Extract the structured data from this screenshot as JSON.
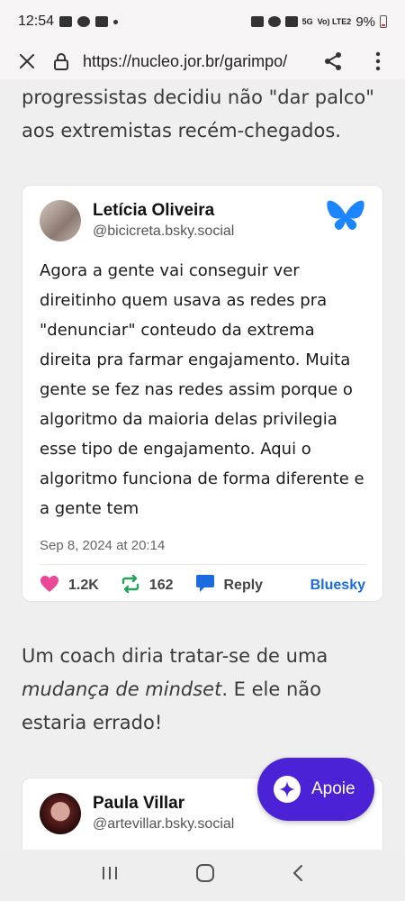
{
  "status": {
    "time": "12:54",
    "network": "5G",
    "carrier": "Vo) LTE2",
    "battery": "9%"
  },
  "browser": {
    "url": "https://nucleo.jor.br/garimpo/"
  },
  "article": {
    "lead_text": "progressistas decidiu não \"dar palco\" aos extremistas recém-chegados.",
    "para2_before": "Um coach diria tratar-se de uma ",
    "para2_em": "mudança de mindset",
    "para2_after": ". E ele não estaria errado!"
  },
  "posts": [
    {
      "author": "Letícia Oliveira",
      "handle": "@bicicreta.bsky.social",
      "body": "Agora a gente vai conseguir ver direitinho quem usava as redes pra \"denunciar\" conteudo da extrema direita pra farmar engajamento. Muita gente se fez nas redes assim porque o algoritmo da maioria delas privilegia esse tipo de engajamento. Aqui o algoritmo funciona de forma diferente e a gente tem",
      "date": "Sep 8, 2024 at 20:14",
      "likes": "1.2K",
      "reposts": "162",
      "reply_label": "Reply",
      "source_label": "Bluesky"
    },
    {
      "author": "Paula Villar",
      "handle": "@artevillar.bsky.social"
    }
  ],
  "cta": {
    "label": "Apoie"
  },
  "colors": {
    "bluesky": "#1a85ff",
    "cta": "#4b22d6",
    "heart": "#ec4899",
    "repost": "#22a35a",
    "reply": "#1a6be0"
  }
}
